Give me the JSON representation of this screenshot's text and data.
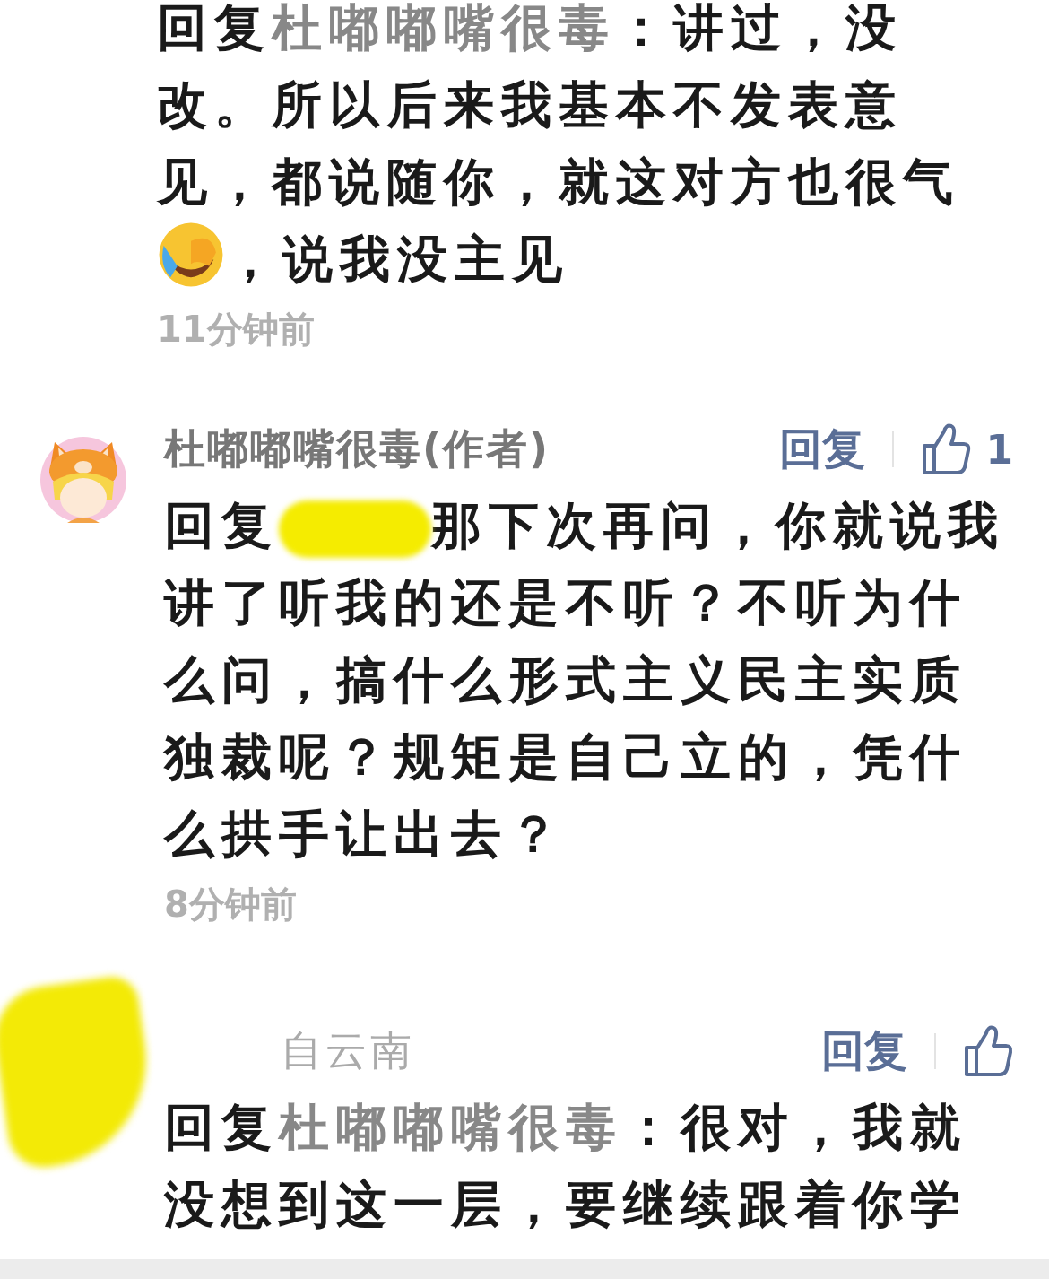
{
  "comments": [
    {
      "body": [
        {
          "kind": "prefix",
          "text": "回复"
        },
        {
          "kind": "mention",
          "text": "杜嘟嘟嘴很毒"
        },
        {
          "kind": "text",
          "text": "：讲过，没改。所以后来我基本不发表意见，都说随你，就这对方也很气"
        },
        {
          "kind": "emoji"
        },
        {
          "kind": "text",
          "text": "，说我没主见"
        }
      ],
      "time": "11分钟前"
    },
    {
      "author": {
        "name": "杜嘟嘟嘴很毒(作者)",
        "redacted": false
      },
      "reply": "回复",
      "likes": "1",
      "body": [
        {
          "kind": "prefix",
          "text": "回复"
        },
        {
          "kind": "redaction"
        },
        {
          "kind": "text",
          "text": "那下次再问，你就说我讲了听我的还是不听？不听为什么问，搞什么形式主义民主实质独裁呢？规矩是自己立的，凭什么拱手让出去？"
        }
      ],
      "time": "8分钟前"
    },
    {
      "author": {
        "name": "自云南",
        "redacted": true
      },
      "reply": "回复",
      "body": [
        {
          "kind": "prefix",
          "text": "回复"
        },
        {
          "kind": "mention",
          "text": "杜嘟嘟嘴很毒"
        },
        {
          "kind": "text",
          "text": "：很对，我就没想到这一层，要继续跟着你学"
        }
      ]
    }
  ]
}
